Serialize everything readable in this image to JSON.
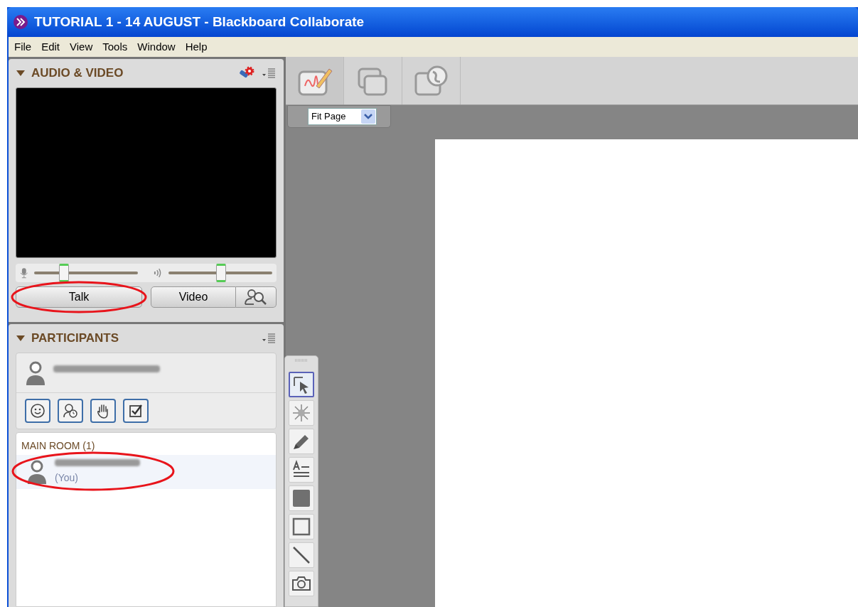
{
  "window": {
    "title": "TUTORIAL 1 - 14 AUGUST - Blackboard Collaborate"
  },
  "menu": [
    {
      "label": "File"
    },
    {
      "label": "Edit"
    },
    {
      "label": "View"
    },
    {
      "label": "Tools"
    },
    {
      "label": "Window"
    },
    {
      "label": "Help"
    }
  ],
  "audio_video": {
    "title": "AUDIO & VIDEO",
    "expanded": true,
    "mic": {
      "level": 0.28
    },
    "speaker": {
      "level": 0.49
    },
    "buttons": [
      {
        "label": "Talk",
        "annotated": true
      },
      {
        "label": "Video",
        "annotated": false
      }
    ]
  },
  "participants": {
    "title": "PARTICIPANTS",
    "expanded": true,
    "room": "MAIN ROOM (1)",
    "self_note": "(You)"
  },
  "content_tabs": [
    {
      "kind": "whiteboard",
      "selected": true
    },
    {
      "kind": "screens",
      "selected": false
    },
    {
      "kind": "web",
      "selected": false
    }
  ],
  "zoom": {
    "value": "Fit Page"
  },
  "tools": [
    {
      "kind": "select",
      "selected": true
    },
    {
      "kind": "pointer",
      "selected": false
    },
    {
      "kind": "pen",
      "selected": false
    },
    {
      "kind": "text",
      "selected": false
    },
    {
      "kind": "filled-rect",
      "selected": false
    },
    {
      "kind": "rect",
      "selected": false
    },
    {
      "kind": "line",
      "selected": false
    },
    {
      "kind": "camera",
      "selected": false
    }
  ]
}
